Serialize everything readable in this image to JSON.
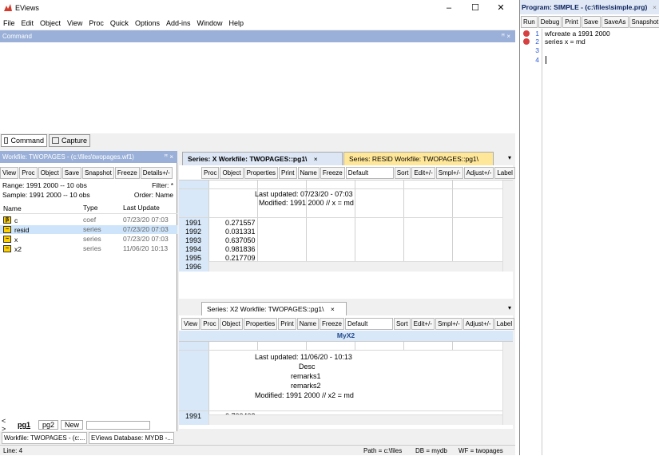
{
  "app": {
    "title": "EViews",
    "minimize": "–",
    "maximize": "☐",
    "close": "✕"
  },
  "menu": [
    "File",
    "Edit",
    "Object",
    "View",
    "Proc",
    "Quick",
    "Options",
    "Add-ins",
    "Window",
    "Help"
  ],
  "command": {
    "title": "Command",
    "pin": "ꟸ ×",
    "tabs": [
      "Command",
      "Capture"
    ]
  },
  "workfile": {
    "title": "Workfile: TWOPAGES - (c:\\files\\twopages.wf1)",
    "controls": "ꟸ ×",
    "buttons": [
      "View",
      "Proc",
      "Object",
      "Save",
      "Snapshot",
      "Freeze",
      "Details+/-"
    ],
    "range_label": "Range: 1991 2000  --  10 obs",
    "filter": "Filter: *",
    "sample_label": "Sample: 1991 2000  --  10 obs",
    "order": "Order: Name",
    "columns": [
      "Name",
      "Type",
      "Last Update"
    ],
    "objects": [
      {
        "name": "c",
        "type": "coef",
        "updated": "07/23/20  07:03",
        "icon": "β"
      },
      {
        "name": "resid",
        "type": "series",
        "updated": "07/23/20  07:03",
        "icon": "~"
      },
      {
        "name": "x",
        "type": "series",
        "updated": "07/23/20  07:03",
        "icon": "~"
      },
      {
        "name": "x2",
        "type": "series",
        "updated": "11/06/20  10:13",
        "icon": "~"
      }
    ],
    "page_tabs": [
      "pg1",
      "pg2",
      "New"
    ]
  },
  "series_pane1": {
    "tab1": "Series: X   Workfile: TWOPAGES::pg1\\",
    "tab1_close": "×",
    "tab2": "Series: RESID   Workfile: TWOPAGES::pg1\\",
    "buttons": [
      "Proc",
      "Object",
      "Properties",
      "Print",
      "Name",
      "Freeze",
      "Default",
      "Sort",
      "Edit+/-",
      "Smpl+/-",
      "Adjust+/-",
      "Label"
    ],
    "header_lines": [
      "Last updated: 07/23/20 - 07:03",
      "Modified: 1991 2000 // x = md"
    ],
    "rows": [
      {
        "obs": "1991",
        "value": "0.271557"
      },
      {
        "obs": "1992",
        "value": "0.031331"
      },
      {
        "obs": "1993",
        "value": "0.637050"
      },
      {
        "obs": "1994",
        "value": "0.981836"
      },
      {
        "obs": "1995",
        "value": "0.217709"
      },
      {
        "obs": "1996",
        "value": ""
      }
    ]
  },
  "series_pane2": {
    "tab": "Series: X2   Workfile: TWOPAGES::pg1\\",
    "tab_close": "×",
    "buttons": [
      "View",
      "Proc",
      "Object",
      "Properties",
      "Print",
      "Name",
      "Freeze",
      "Default",
      "Sort",
      "Edit+/-",
      "Smpl+/-",
      "Adjust+/-",
      "Label"
    ],
    "column_title": "MyX2",
    "header_lines": [
      "Last updated: 11/06/20 - 10:13",
      "Desc",
      "remarks1",
      "remarks2",
      "Modified: 1991 2000 // x2 = md"
    ],
    "rows": [
      {
        "obs": "1991",
        "value": "0.700403"
      }
    ]
  },
  "taskbar": [
    "Workfile: TWOPAGES - (c:...",
    "EViews Database: MYDB -..."
  ],
  "status": {
    "line": "Line: 4",
    "path": "Path = c:\\files",
    "db": "DB = mydb",
    "wf": "WF = twopages"
  },
  "program": {
    "title": "Program: SIMPLE - (c:\\files\\simple.prg)",
    "close": "×",
    "buttons": [
      "Run",
      "Debug",
      "Print",
      "Save",
      "SaveAs",
      "Snapshot"
    ],
    "lines": [
      {
        "num": "1",
        "code": "wfcreate a 1991 2000",
        "breakpoint": true
      },
      {
        "num": "2",
        "code": "series x = md",
        "breakpoint": true
      },
      {
        "num": "3",
        "code": "",
        "breakpoint": false
      },
      {
        "num": "4",
        "code": "",
        "breakpoint": false
      }
    ]
  }
}
